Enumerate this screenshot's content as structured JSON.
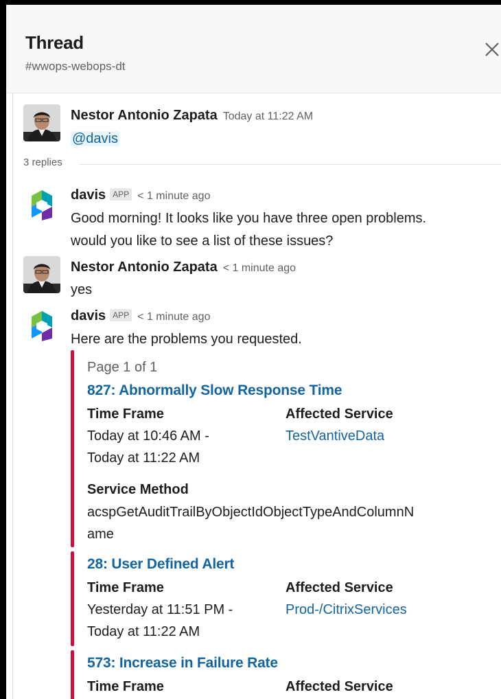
{
  "header": {
    "title": "Thread",
    "channel": "#wwops-webops-dt",
    "close_icon": "close-icon"
  },
  "parent_message": {
    "author": "Nestor Antonio Zapata",
    "time": "Today at 11:22 AM",
    "text": "@davis"
  },
  "replies_label": "3 replies",
  "messages": [
    {
      "author": "davis",
      "badge": "APP",
      "time": "< 1 minute ago",
      "line1": "Good morning! It looks like you have three open problems.",
      "line2": "would you like to see a list of these issues?"
    },
    {
      "author": "Nestor Antonio Zapata",
      "time": "< 1 minute ago",
      "text": "yes"
    },
    {
      "author": "davis",
      "badge": "APP",
      "time": "< 1 minute ago",
      "text": "Here are the problems you requested."
    }
  ],
  "problems": {
    "page": "Page 1 of 1",
    "items": [
      {
        "title": "827: Abnormally Slow Response Time",
        "time_frame_label": "Time Frame",
        "time_frame_line1": "Today at 10:46 AM -",
        "time_frame_line2": "Today at 11:22 AM",
        "service_label": "Affected Service",
        "service": "TestVantiveData",
        "method_label": "Service Method",
        "method_line1": "acspGetAuditTrailByObjectIdObjectTypeAndColumnN",
        "method_line2": "ame"
      },
      {
        "title": "28: User Defined Alert",
        "time_frame_label": "Time Frame",
        "time_frame_line1": "Yesterday at 11:51 PM -",
        "time_frame_line2": "Today at 11:22 AM",
        "service_label": "Affected Service",
        "service": "Prod-/CitrixServices"
      },
      {
        "title": "573: Increase in Failure Rate",
        "time_frame_label": "Time Frame",
        "service_label": "Affected Service"
      }
    ],
    "bar_color": "#d0103a"
  },
  "colors": {
    "link": "#1264a3",
    "accent_bar": "#d0103a"
  }
}
